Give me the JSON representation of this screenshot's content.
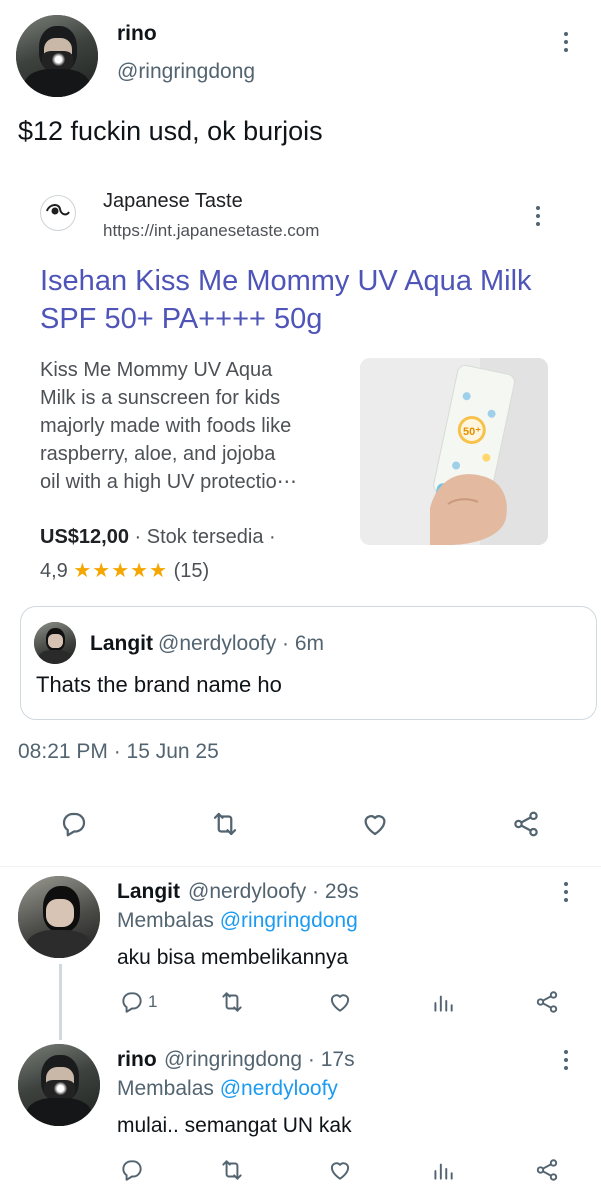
{
  "tweet": {
    "author_name": "rino",
    "author_handle": "@ringringdong",
    "text": "$12 fuckin usd, ok burjois",
    "timestamp": "08:21 PM · 15 Jun 25"
  },
  "link_card": {
    "source_name": "Japanese Taste",
    "source_url": "https://int.japanesetaste.com",
    "title": "Isehan Kiss Me Mommy UV Aqua Milk SPF 50+ PA++++ 50g",
    "description_lines": [
      "Kiss Me Mommy UV Aqua",
      "Milk is a sunscreen for kids",
      "majorly made with foods like",
      "raspberry, aloe, and jojoba",
      "oil with a high UV protectio⋯"
    ],
    "price": "US$12,00",
    "stock": "· Stok tersedia ·",
    "rating": "4,9",
    "stars": "★★★★★",
    "review_count": "(15)",
    "image_label": "50⁺"
  },
  "quote": {
    "author_name": "Langit",
    "author_handle": "@nerdyloofy · 6m",
    "text": "Thats the brand name ho"
  },
  "replies": [
    {
      "author_name": "Langit",
      "author_handle": "@nerdyloofy · 29s",
      "reply_label": "Membalas",
      "reply_mention": "@ringringdong",
      "text": "aku bisa membelikannya",
      "reply_count": "1"
    },
    {
      "author_name": "rino",
      "author_handle": "@ringringdong · 17s",
      "reply_label": "Membalas",
      "reply_mention": "@nerdyloofy",
      "text": "mulai.. semangat UN kak",
      "reply_count": ""
    }
  ],
  "icons": {
    "reply": "reply-icon",
    "retweet": "retweet-icon",
    "like": "heart-icon",
    "share": "share-icon",
    "stats": "stats-icon",
    "more": "more-vertical-icon"
  },
  "colors": {
    "link_title": "#4e54b8",
    "mention": "#1d9bf0",
    "star": "#f5a700",
    "muted": "#536471"
  }
}
